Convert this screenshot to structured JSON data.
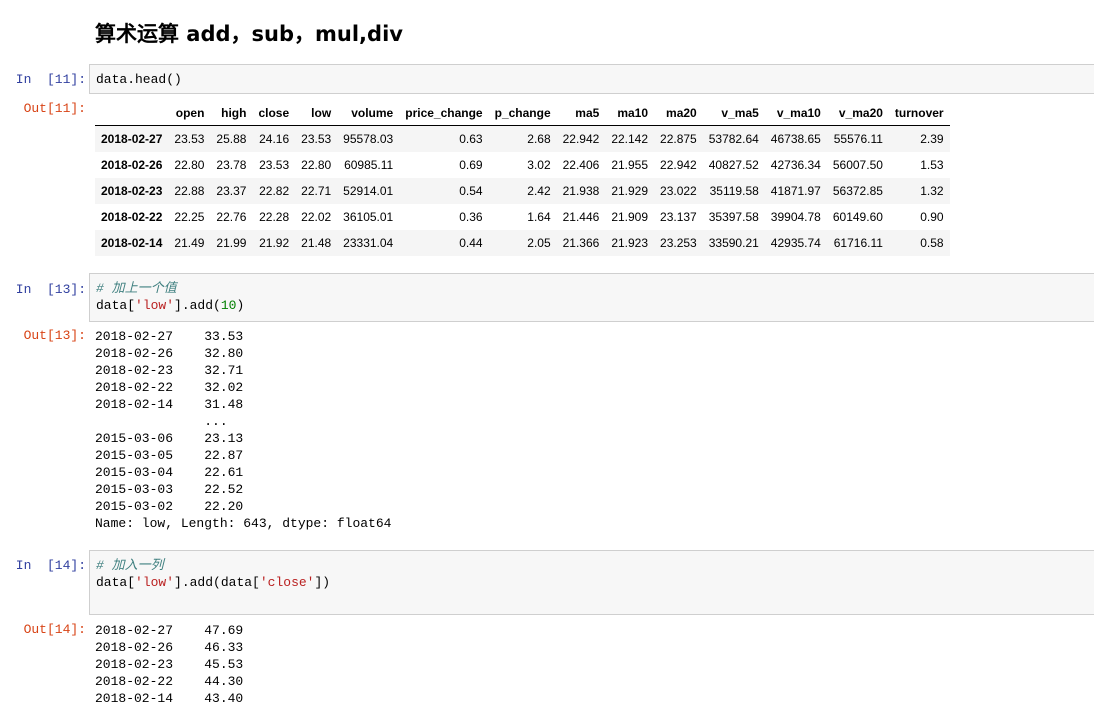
{
  "heading": "算术运算 add，sub，mul,div",
  "cells": [
    {
      "in_prompt": "In  [11]:",
      "code": "data.head()",
      "out_prompt": "Out[11]:",
      "table": {
        "columns": [
          "",
          "open",
          "high",
          "close",
          "low",
          "volume",
          "price_change",
          "p_change",
          "ma5",
          "ma10",
          "ma20",
          "v_ma5",
          "v_ma10",
          "v_ma20",
          "turnover"
        ],
        "rows": [
          [
            "2018-02-27",
            "23.53",
            "25.88",
            "24.16",
            "23.53",
            "95578.03",
            "0.63",
            "2.68",
            "22.942",
            "22.142",
            "22.875",
            "53782.64",
            "46738.65",
            "55576.11",
            "2.39"
          ],
          [
            "2018-02-26",
            "22.80",
            "23.78",
            "23.53",
            "22.80",
            "60985.11",
            "0.69",
            "3.02",
            "22.406",
            "21.955",
            "22.942",
            "40827.52",
            "42736.34",
            "56007.50",
            "1.53"
          ],
          [
            "2018-02-23",
            "22.88",
            "23.37",
            "22.82",
            "22.71",
            "52914.01",
            "0.54",
            "2.42",
            "21.938",
            "21.929",
            "23.022",
            "35119.58",
            "41871.97",
            "56372.85",
            "1.32"
          ],
          [
            "2018-02-22",
            "22.25",
            "22.76",
            "22.28",
            "22.02",
            "36105.01",
            "0.36",
            "1.64",
            "21.446",
            "21.909",
            "23.137",
            "35397.58",
            "39904.78",
            "60149.60",
            "0.90"
          ],
          [
            "2018-02-14",
            "21.49",
            "21.99",
            "21.92",
            "21.48",
            "23331.04",
            "0.44",
            "2.05",
            "21.366",
            "21.923",
            "23.253",
            "33590.21",
            "42935.74",
            "61716.11",
            "0.58"
          ]
        ]
      }
    },
    {
      "in_prompt": "In  [13]:",
      "comment": "# 加上一个值",
      "code_pre": "data[",
      "code_str": "'low'",
      "code_mid": "].add(",
      "code_num": "10",
      "code_post": ")",
      "out_prompt": "Out[13]:",
      "output": "2018-02-27    33.53\n2018-02-26    32.80\n2018-02-23    32.71\n2018-02-22    32.02\n2018-02-14    31.48\n              ...  \n2015-03-06    23.13\n2015-03-05    22.87\n2015-03-04    22.61\n2015-03-03    22.52\n2015-03-02    22.20\nName: low, Length: 643, dtype: float64"
    },
    {
      "in_prompt": "In  [14]:",
      "comment": "# 加入一列",
      "code_pre": "data[",
      "code_str": "'low'",
      "code_mid": "].add(data[",
      "code_str2": "'close'",
      "code_post": "])",
      "out_prompt": "Out[14]:",
      "output": "2018-02-27    47.69\n2018-02-26    46.33\n2018-02-23    45.53\n2018-02-22    44.30\n2018-02-14    43.40"
    }
  ]
}
